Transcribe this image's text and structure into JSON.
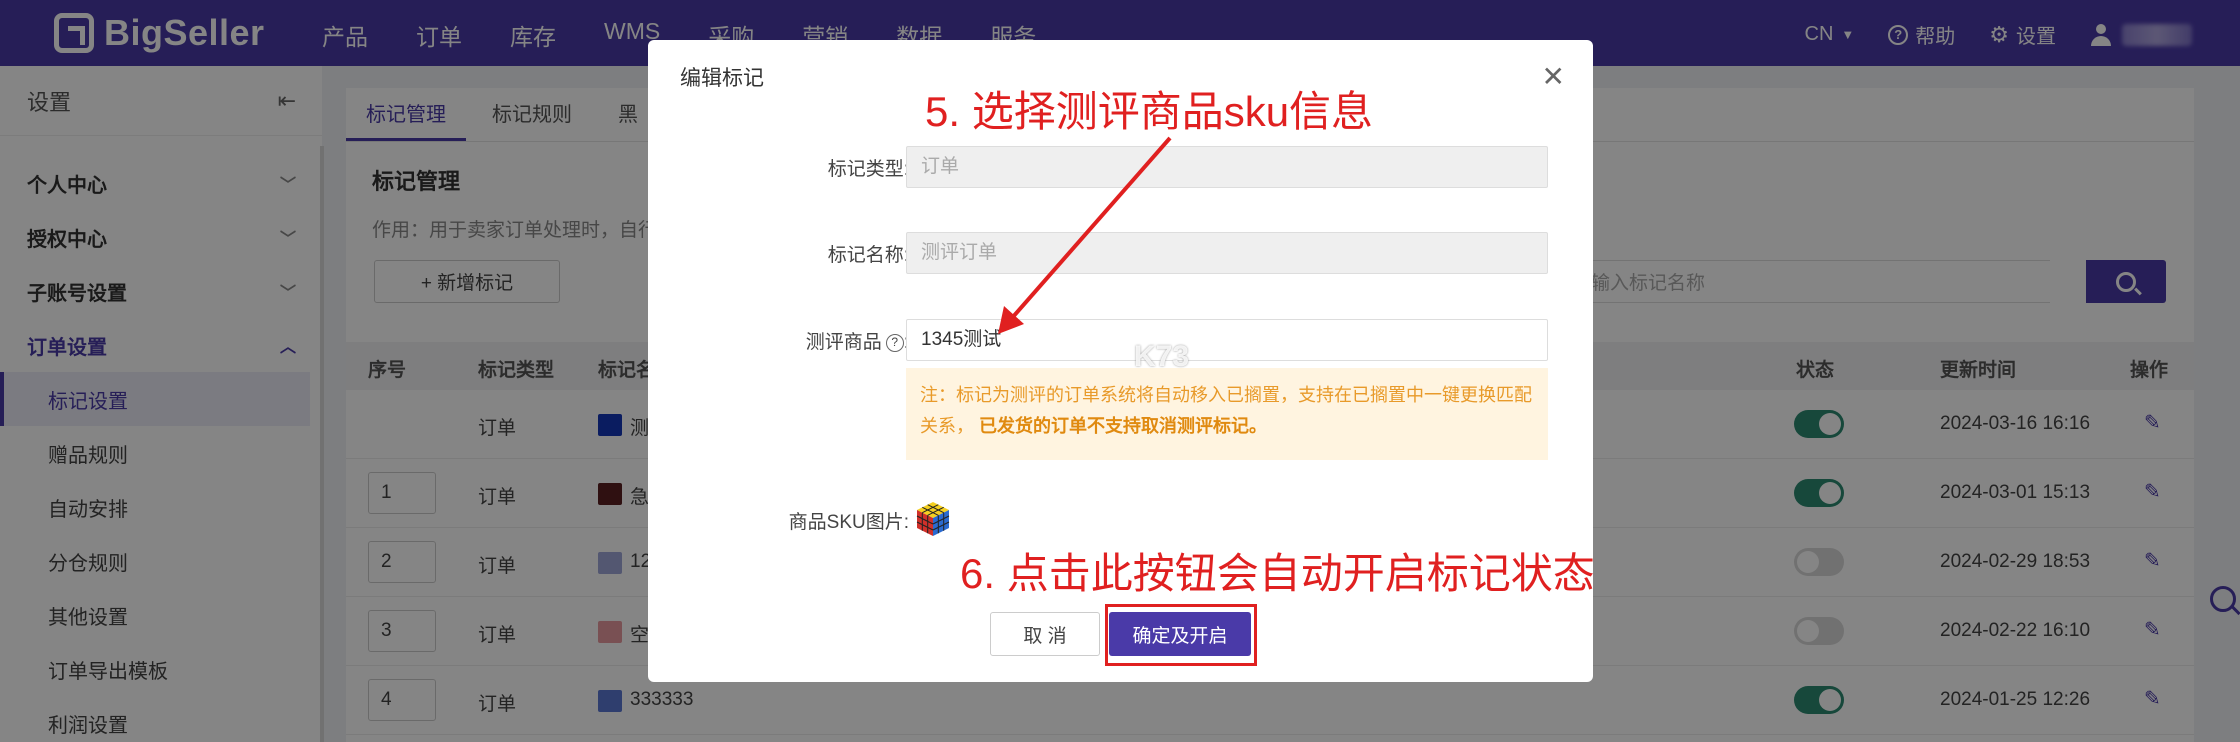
{
  "topbar": {
    "brand": "BigSeller",
    "nav": [
      "产品",
      "订单",
      "库存",
      "WMS",
      "采购",
      "营销",
      "数据",
      "服务"
    ],
    "lang": "CN",
    "help": "帮助",
    "settings": "设置"
  },
  "sidebar": {
    "title": "设置",
    "groups": [
      {
        "label": "个人中心"
      },
      {
        "label": "授权中心"
      },
      {
        "label": "子账号设置"
      },
      {
        "label": "订单设置"
      }
    ],
    "items": [
      "标记设置",
      "赠品规则",
      "自动安排",
      "分仓规则",
      "其他设置",
      "订单导出模板",
      "利润设置"
    ]
  },
  "content": {
    "tabs": [
      "标记管理",
      "标记规则",
      "黑"
    ],
    "title": "标记管理",
    "desc": "作用：用于卖家订单处理时，自行",
    "add_button": "+ 新增标记",
    "search_placeholder": "输入标记名称",
    "headers": {
      "index": "序号",
      "type": "标记类型",
      "name": "标记名",
      "status": "状态",
      "updated": "更新时间",
      "actions": "操作"
    },
    "rows": [
      {
        "index": "",
        "type": "订单",
        "color": "#1436b8",
        "name": "测",
        "on": true,
        "time": "2024-03-16 16:16"
      },
      {
        "index": "1",
        "type": "订单",
        "color": "#5a1f22",
        "name": "急",
        "on": true,
        "time": "2024-03-01 15:13"
      },
      {
        "index": "2",
        "type": "订单",
        "color": "#9fa8d8",
        "name": "12",
        "on": false,
        "time": "2024-02-29 18:53"
      },
      {
        "index": "3",
        "type": "订单",
        "color": "#e89aa0",
        "name": "空",
        "on": false,
        "time": "2024-02-22 16:10"
      },
      {
        "index": "4",
        "type": "订单",
        "color": "#5b78d4",
        "name": "333333",
        "on": true,
        "time": "2024-01-25 12:26"
      }
    ]
  },
  "modal": {
    "title": "编辑标记",
    "type_label": "标记类型:",
    "type_value": "订单",
    "name_label": "标记名称:",
    "name_value": "测评订单",
    "product_label": "测评商品",
    "product_value": "1345测试",
    "notice_text": "注：标记为测评的订单系统将自动移入已搁置，支持在已搁置中一键更换匹配关系，",
    "notice_bold": "已发货的订单不支持取消测评标记。",
    "sku_image_label": "商品SKU图片:",
    "cancel": "取 消",
    "confirm": "确定及开启"
  },
  "annotations": {
    "step5": "5. 选择测评商品sku信息",
    "step6": "6. 点击此按钮会自动开启标记状态"
  },
  "watermark": "K73"
}
